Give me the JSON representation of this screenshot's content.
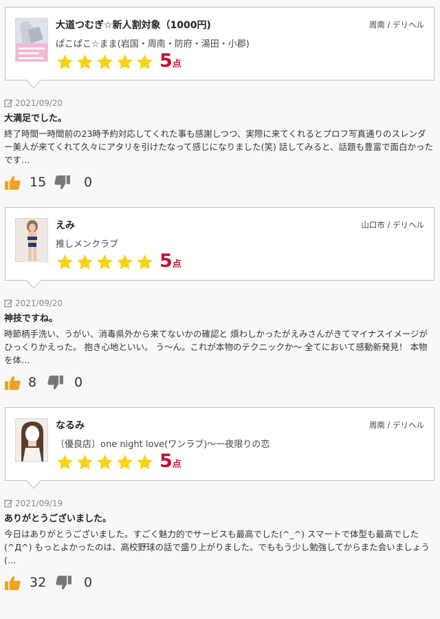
{
  "reviews": [
    {
      "girl_name": "大道つむぎ☆新人割対象（1000円)",
      "shop_name": "ぱこぱこ☆まま(岩国・周南・防府・湯田・小郡)",
      "area": "周南 / デリヘル",
      "rating": 5,
      "score_number": "5",
      "score_unit": "点",
      "date": "2021/09/20",
      "title": "大満足でした。",
      "body": "終了時間一時間前の23時予約対応してくれた事も感謝しつつ、実際に来てくれるとプロフ写真通りのスレンダー美人が来てくれて久々にアタリを引けたなって感じになりました(笑) 話してみると、話題も豊富で面白かったです…",
      "likes": "15",
      "dislikes": "0",
      "thumbnail": "photo-woman-pink-promo"
    },
    {
      "girl_name": "えみ",
      "shop_name": "推しメンクラブ",
      "area": "山口市 / デリヘル",
      "rating": 5,
      "score_number": "5",
      "score_unit": "点",
      "date": "2021/09/20",
      "title": "神技ですね。",
      "body": "時節柄手洗い、うがい、消毒県外から来てないかの確認と 煩わしかったがえみさんがきてマイナスイメージがひっくりかえった。 抱き心地といい。 う〜ん。これが本物のテクニックか〜 全てにおいて感動新発見！ 本物を体…",
      "likes": "8",
      "dislikes": "0",
      "thumbnail": "photo-woman-standing"
    },
    {
      "girl_name": "なるみ",
      "shop_name": "〔優良店〕one night love(ワンラブ)〜一夜限りの恋",
      "area": "周南 / デリヘル",
      "rating": 5,
      "score_number": "5",
      "score_unit": "点",
      "date": "2021/09/19",
      "title": "ありがとうございました。",
      "body": "今日はありがとうございました。すごく魅力的でサービスも最高でした(^_^) スマートで体型も最高でした(^Д^) もっとよかったのは、高校野球の話で盛り上がりました。でももう少し勉強してからまた会いましょう(…",
      "likes": "32",
      "dislikes": "0",
      "thumbnail": "photo-woman-blurred-face"
    }
  ],
  "icons": {
    "star": "star-icon",
    "edit": "edit-icon",
    "like": "thumbs-up-icon",
    "dislike": "thumbs-down-icon"
  },
  "colors": {
    "star": "#f8d31a",
    "score": "#c8102e",
    "like": "#f0a21e",
    "dislike": "#777777"
  }
}
